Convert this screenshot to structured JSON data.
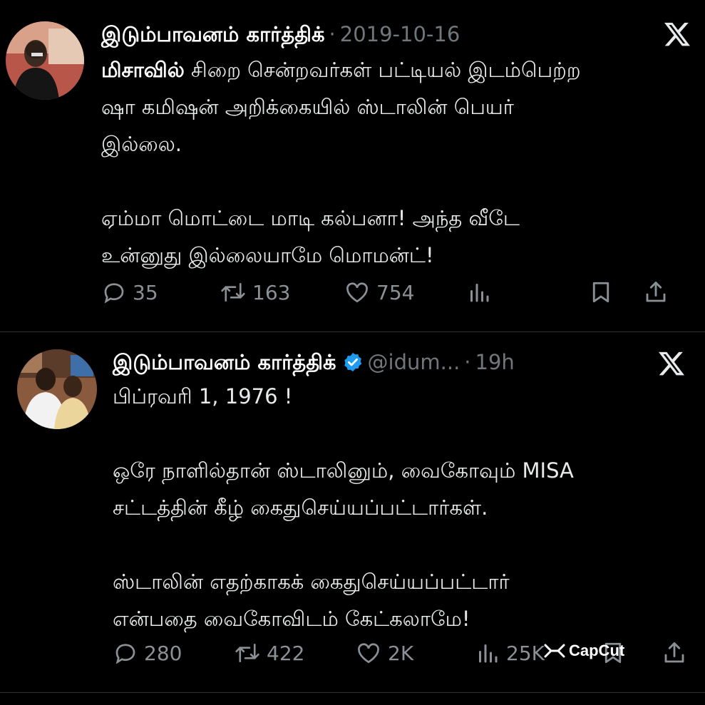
{
  "tweets": [
    {
      "author": "இடும்பாவனம் கார்த்திக்",
      "separator": "·",
      "date": "2019-10-16",
      "text_bold": "மிசாவில்",
      "text": " சிறை சென்றவர்கள் பட்டியல் இடம்பெற்ற\nஷா கமிஷன் அறிக்கையில் ஸ்டாலின் பெயர்\nஇல்லை.\n\nஏம்மா மொட்டை மாடி கல்பனா! அந்த வீடே\nஉன்னுது இல்லையாமே மொமன்ட்!",
      "stats": {
        "replies": "35",
        "reposts": "163",
        "likes": "754"
      }
    },
    {
      "author": "இடும்பாவனம் கார்த்திக்",
      "handle": "@idum...",
      "separator": "·",
      "date": "19h",
      "text": "பிப்ரவரி 1, 1976 !\n\nஒரே நாளில்தான் ஸ்டாலினும், வைகோவும் MISA\nசட்டத்தின் கீழ் கைதுசெய்யப்பட்டார்கள்.\n\nஸ்டாலின் எதற்காகக் கைதுசெய்யப்பட்டார்\nஎன்பதை வைகோவிடம் கேட்கலாமே!",
      "stats": {
        "replies": "280",
        "reposts": "422",
        "likes": "2K",
        "views": "25K"
      }
    }
  ],
  "watermark": {
    "text": "CapCut"
  },
  "colors": {
    "background": "#000000",
    "text": "#e7e9ea",
    "muted": "#71767b",
    "verified": "#1d9bf0"
  },
  "icons": [
    "reply-icon",
    "repost-icon",
    "like-icon",
    "views-icon",
    "bookmark-icon",
    "share-icon",
    "x-logo-icon",
    "verified-badge-icon"
  ]
}
